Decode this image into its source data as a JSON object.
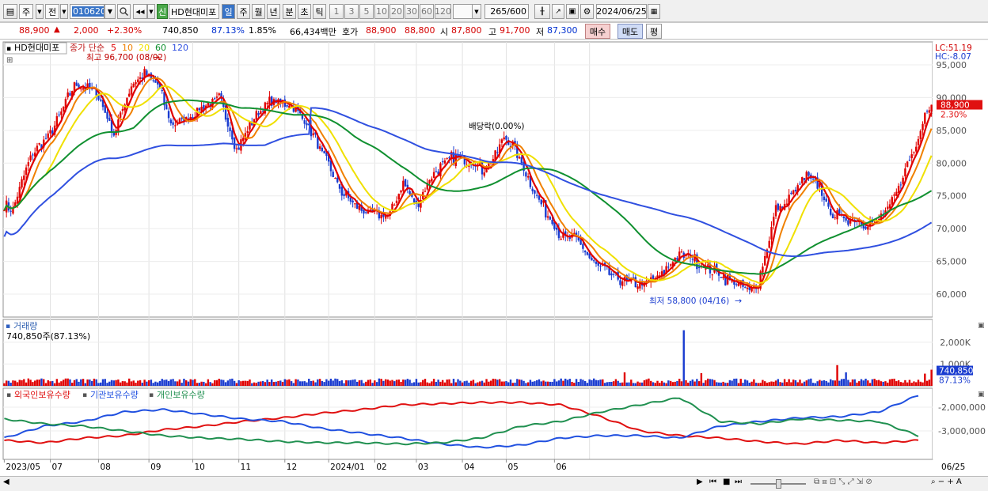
{
  "toolbar": {
    "mode": "주",
    "prev": "전",
    "code": "010620",
    "name": "HD현대미포",
    "sin": "신",
    "periods": [
      "일",
      "주",
      "월",
      "년",
      "분",
      "초",
      "틱"
    ],
    "active_period": "일",
    "intervals": [
      "1",
      "3",
      "5",
      "10",
      "20",
      "30",
      "60",
      "120"
    ],
    "count": "265",
    "count_max": "/600",
    "date": "2024/06/25"
  },
  "quote": {
    "price": "88,900",
    "change": "2,000",
    "pct": "+2.30%",
    "volume": "740,850",
    "vol_ratio": "87.13%",
    "turnover": "1.85%",
    "amount": "66,434백만",
    "hoga_label": "호가",
    "ask": "88,900",
    "bid": "88,800",
    "open_label": "시",
    "open": "87,800",
    "high_label": "고",
    "high": "91,700",
    "low_label": "저",
    "low": "87,300",
    "buy": "매수",
    "sell": "매도",
    "eval": "평"
  },
  "price_panel": {
    "name": "HD현대미포",
    "ma_label": "종가 단순",
    "ma": [
      "5",
      "10",
      "20",
      "60",
      "120"
    ],
    "ma_colors": [
      "#e00000",
      "#f08000",
      "#f0e000",
      "#109030",
      "#3050e0"
    ],
    "high_note": "최고 96,700 (08/02)",
    "low_note": "최저 58,800 (04/16)",
    "div_note": "배당락(0.00%)",
    "lc": "LC:51.19",
    "hc": "HC:-8.07",
    "cur_price": "88,900",
    "cur_pct": "2.30%",
    "yticks": [
      "95,000",
      "90,000",
      "85,000",
      "80,000",
      "75,000",
      "70,000",
      "65,000",
      "60,000"
    ]
  },
  "volume_panel": {
    "title": "거래량",
    "value": "740,850주(87.13%)",
    "yticks": [
      "2,000K",
      "1,000K"
    ],
    "tag_value": "740,850",
    "tag_pct": "87.13%"
  },
  "holding_panel": {
    "legend": [
      "외국인보유수량",
      "기관보유수량",
      "개인보유수량"
    ],
    "colors": [
      "#e01010",
      "#2050e0",
      "#209050"
    ],
    "yticks": [
      "-2,000,000",
      "-3,000,000"
    ]
  },
  "x_axis": [
    "2023/05",
    "07",
    "08",
    "09",
    "10",
    "11",
    "12",
    "2024/01",
    "02",
    "03",
    "04",
    "05",
    "06",
    "06/25"
  ],
  "chart_data": [
    {
      "type": "line",
      "title": "HD현대미포",
      "series": [
        "5",
        "10",
        "20",
        "60",
        "120"
      ],
      "ylim": [
        56500,
        98500
      ],
      "high": {
        "value": 96700,
        "date": "08/02"
      },
      "low": {
        "value": 58800,
        "date": "04/16"
      },
      "close": 88900,
      "anchors": [
        [
          0,
          73500
        ],
        [
          4,
          73000
        ],
        [
          12,
          81000
        ],
        [
          22,
          85000
        ],
        [
          32,
          92000
        ],
        [
          42,
          91000
        ],
        [
          50,
          84500
        ],
        [
          58,
          92000
        ],
        [
          64,
          93500
        ],
        [
          70,
          92000
        ],
        [
          76,
          86000
        ],
        [
          82,
          86500
        ],
        [
          90,
          88500
        ],
        [
          98,
          90000
        ],
        [
          106,
          82000
        ],
        [
          114,
          87000
        ],
        [
          122,
          89500
        ],
        [
          130,
          89000
        ],
        [
          138,
          86000
        ],
        [
          146,
          81000
        ],
        [
          154,
          75500
        ],
        [
          162,
          73000
        ],
        [
          170,
          72000
        ],
        [
          176,
          72000
        ],
        [
          182,
          77000
        ],
        [
          188,
          73500
        ],
        [
          194,
          77500
        ],
        [
          200,
          80000
        ],
        [
          206,
          81000
        ],
        [
          212,
          80500
        ],
        [
          218,
          79000
        ],
        [
          224,
          81000
        ],
        [
          228,
          84000
        ],
        [
          232,
          82500
        ],
        [
          236,
          80000
        ],
        [
          242,
          75500
        ],
        [
          248,
          72000
        ],
        [
          254,
          69000
        ],
        [
          262,
          68000
        ],
        [
          268,
          65000
        ],
        [
          276,
          63000
        ],
        [
          284,
          62000
        ],
        [
          292,
          61500
        ],
        [
          300,
          63000
        ],
        [
          306,
          65500
        ],
        [
          312,
          66000
        ],
        [
          318,
          64500
        ],
        [
          324,
          63500
        ],
        [
          328,
          62500
        ],
        [
          334,
          61500
        ],
        [
          340,
          60500
        ],
        [
          344,
          62000
        ],
        [
          348,
          67000
        ],
        [
          352,
          73000
        ],
        [
          356,
          73500
        ],
        [
          360,
          75500
        ],
        [
          366,
          78000
        ],
        [
          372,
          76500
        ],
        [
          376,
          73000
        ],
        [
          380,
          72000
        ],
        [
          386,
          71500
        ],
        [
          392,
          71000
        ],
        [
          398,
          71000
        ],
        [
          404,
          73500
        ],
        [
          408,
          76000
        ],
        [
          412,
          80000
        ],
        [
          416,
          82500
        ],
        [
          420,
          88000
        ],
        [
          423,
          88900
        ]
      ]
    },
    {
      "type": "bar",
      "title": "거래량",
      "last": 740850,
      "spikes": [
        {
          "i": 310,
          "k": 2550
        },
        {
          "i": 283,
          "k": 620
        },
        {
          "i": 380,
          "k": 950
        },
        {
          "i": 384,
          "k": 620
        },
        {
          "i": 318,
          "k": 580
        },
        {
          "i": 420,
          "k": 560
        }
      ]
    },
    {
      "type": "line",
      "title": "보유수량",
      "series": [
        {
          "name": "외국인보유수량",
          "values": [
            -3.4,
            -3.5,
            -3.3,
            -3.2,
            -2.95,
            -2.8,
            -2.6,
            -2.45,
            -2.25,
            -2.1,
            -1.9,
            -1.85,
            -1.8,
            -1.8,
            -1.9,
            -2.4,
            -3.0,
            -3.2,
            -3.3,
            -3.45,
            -3.55,
            -3.4,
            -3.5,
            -3.4
          ]
        },
        {
          "name": "기관보유수량",
          "values": [
            -3.3,
            -2.8,
            -2.6,
            -2.2,
            -2.1,
            -2.3,
            -2.5,
            -2.6,
            -2.9,
            -3.1,
            -3.3,
            -3.55,
            -3.7,
            -3.6,
            -3.3,
            -3.2,
            -3.2,
            -3.3,
            -2.8,
            -2.6,
            -2.45,
            -2.4,
            -2.2,
            -1.5
          ]
        },
        {
          "name": "개인보유수량",
          "values": [
            -2.5,
            -2.7,
            -2.8,
            -3.0,
            -3.2,
            -3.3,
            -3.35,
            -3.45,
            -3.5,
            -3.5,
            -3.55,
            -3.5,
            -3.3,
            -2.8,
            -2.6,
            -2.2,
            -1.9,
            -1.6,
            -2.6,
            -2.7,
            -2.5,
            -2.55,
            -2.6,
            -3.2
          ]
        }
      ]
    }
  ]
}
